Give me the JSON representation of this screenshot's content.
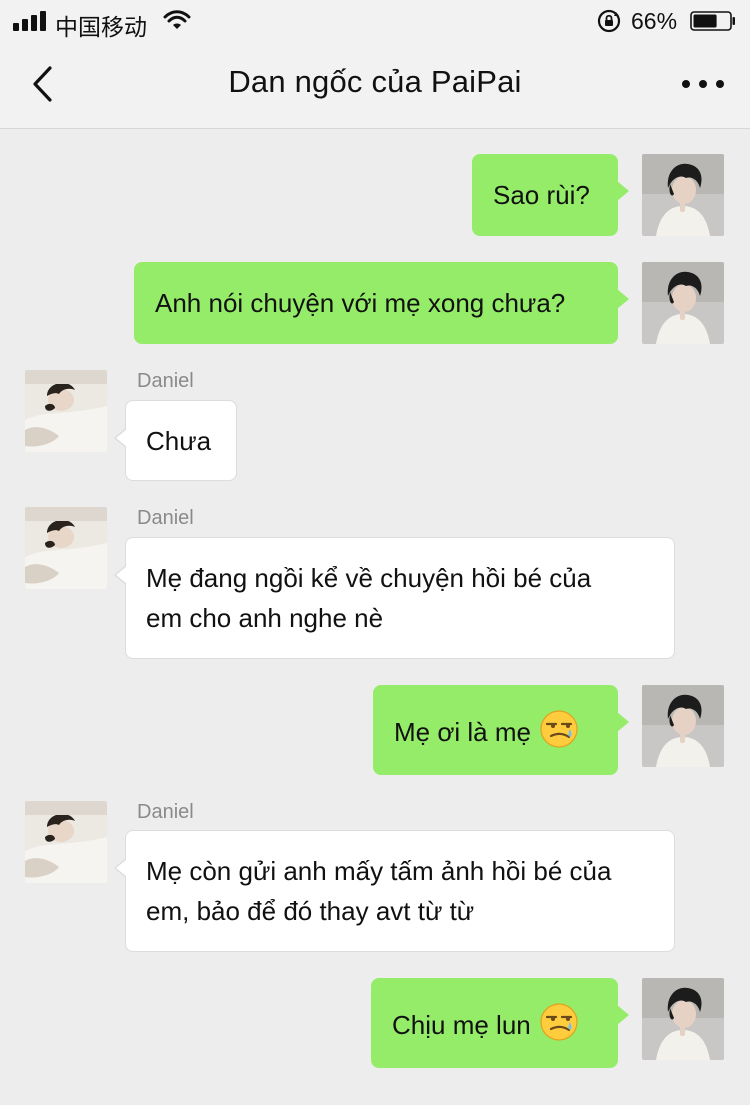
{
  "status_bar": {
    "carrier": "中国移动",
    "battery_percent": "66%",
    "battery_level": 0.66
  },
  "header": {
    "title": "Dan ngốc của PaiPai",
    "back_icon": "chevron-left-icon",
    "more_icon": "more-dots-icon"
  },
  "colors": {
    "outgoing_bubble": "#95ec69",
    "incoming_bubble": "#ffffff",
    "background": "#ededed"
  },
  "messages": [
    {
      "direction": "out",
      "text": "Sao rùi?"
    },
    {
      "direction": "out",
      "text": "Anh nói chuyện với mẹ xong chưa?"
    },
    {
      "direction": "in",
      "sender": "Daniel",
      "text": "Chưa"
    },
    {
      "direction": "in",
      "sender": "Daniel",
      "text": "Mẹ đang ngồi kể về chuyện hồi bé của em cho anh nghe nè"
    },
    {
      "direction": "out",
      "text": "Mẹ ơi là mẹ",
      "emoji": "smirk-sweat-emoji"
    },
    {
      "direction": "in",
      "sender": "Daniel",
      "text": "Mẹ còn gửi anh mấy tấm ảnh hồi bé của em, bảo để đó thay avt từ từ"
    },
    {
      "direction": "out",
      "text": "Chịu mẹ lun",
      "emoji": "smirk-sweat-emoji"
    }
  ]
}
